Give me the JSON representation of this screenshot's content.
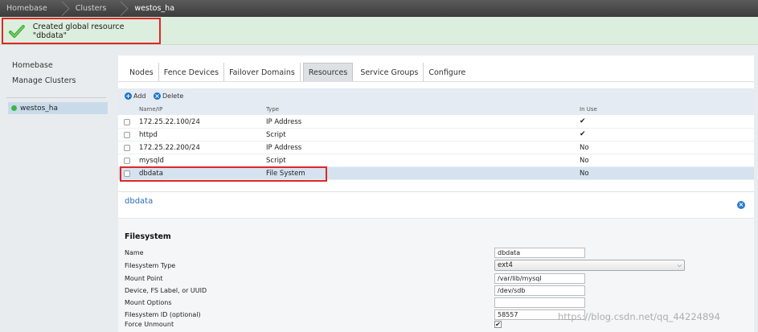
{
  "breadcrumb": [
    "Homebase",
    "Clusters",
    "westos_ha"
  ],
  "message": {
    "text": "Created global resource \"dbdata\""
  },
  "sidebar": {
    "links": [
      "Homebase",
      "Manage Clusters"
    ],
    "cluster": "westos_ha"
  },
  "tabs": [
    {
      "label": "Nodes"
    },
    {
      "label": "Fence Devices"
    },
    {
      "label": "Failover Domains"
    },
    {
      "label": "Resources",
      "active": true
    },
    {
      "label": "Service Groups"
    },
    {
      "label": "Configure"
    }
  ],
  "toolbar": {
    "add": "Add",
    "delete": "Delete"
  },
  "table": {
    "headers": {
      "name": "Name/IP",
      "type": "Type",
      "in_use": "In Use"
    },
    "rows": [
      {
        "name": "172.25.22.100/24",
        "type": "IP Address",
        "in_use": "✔"
      },
      {
        "name": "httpd",
        "type": "Script",
        "in_use": "✔"
      },
      {
        "name": "172.25.22.200/24",
        "type": "IP Address",
        "in_use": "No"
      },
      {
        "name": "mysqld",
        "type": "Script",
        "in_use": "No"
      },
      {
        "name": "dbdata",
        "type": "File System",
        "in_use": "No",
        "selected": true
      }
    ]
  },
  "detail": {
    "title": "dbdata",
    "section": "Filesystem",
    "fields": {
      "name": {
        "label": "Name",
        "value": "dbdata"
      },
      "type": {
        "label": "Filesystem Type",
        "value": "ext4"
      },
      "mount": {
        "label": "Mount Point",
        "value": "/var/lib/mysql"
      },
      "device": {
        "label": "Device, FS Label, or UUID",
        "value": "/dev/sdb"
      },
      "options": {
        "label": "Mount Options",
        "value": ""
      },
      "fsid": {
        "label": "Filesystem ID (optional)",
        "value": "58557"
      },
      "force": {
        "label": "Force Unmount",
        "checked": "✔"
      }
    }
  },
  "watermark": "https://blog.csdn.net/qq_44224894"
}
